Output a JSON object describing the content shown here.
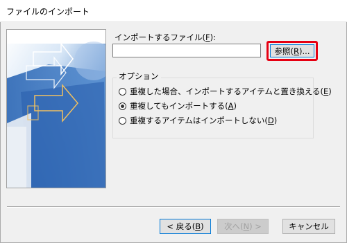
{
  "window": {
    "title": "ファイルのインポート"
  },
  "file_section": {
    "label_prefix": "インポートするファイル(",
    "label_key": "F",
    "label_suffix": "):",
    "path_value": "",
    "browse": {
      "prefix": "参照(",
      "key": "R",
      "suffix": ")..."
    }
  },
  "options": {
    "legend": "オプション",
    "items": [
      {
        "prefix": "重複した場合、インポートするアイテムと置き換える(",
        "key": "E",
        "suffix": ")",
        "selected": false
      },
      {
        "prefix": "重複してもインポートする(",
        "key": "A",
        "suffix": ")",
        "selected": true
      },
      {
        "prefix": "重複するアイテムはインポートしない(",
        "key": "D",
        "suffix": ")",
        "selected": false
      }
    ]
  },
  "footer": {
    "back": {
      "prefix": "< 戻る(",
      "key": "B",
      "suffix": ")",
      "enabled": true
    },
    "next": {
      "prefix": "次へ(",
      "key": "N",
      "suffix": ") >",
      "enabled": false
    },
    "cancel": {
      "label": "キャンセル",
      "enabled": true
    }
  },
  "colors": {
    "highlight": "#e60012",
    "image_blue_dark": "#1f5fae",
    "image_blue_light": "#6fa1d8",
    "arrow_yellow": "#f0c060"
  }
}
